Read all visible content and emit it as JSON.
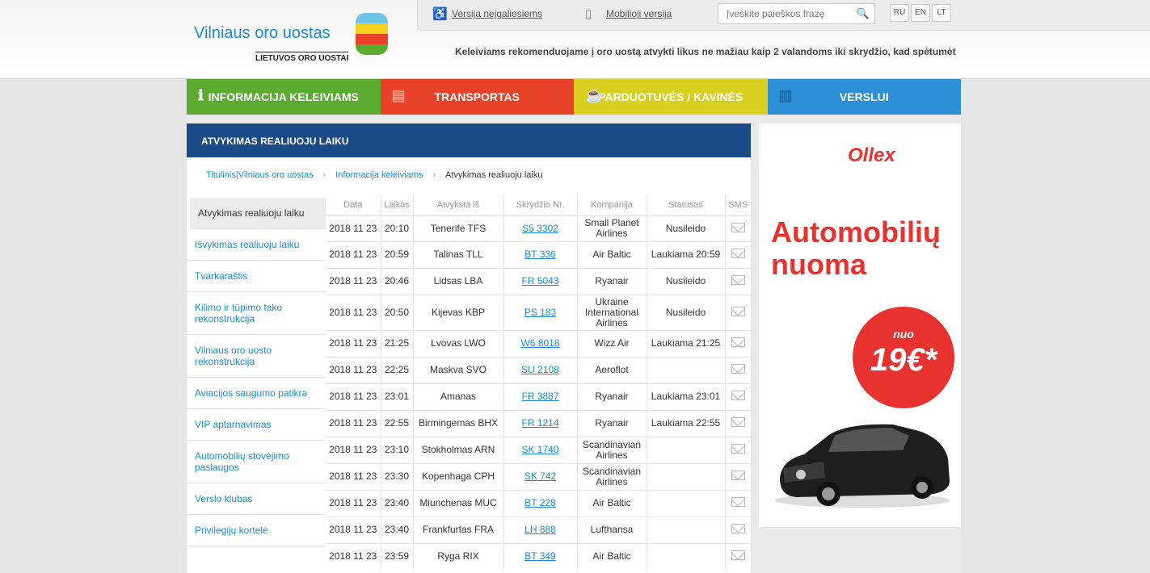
{
  "header": {
    "logo_title": "Vilniaus oro uostas",
    "logo_subtitle": "LIETUVOS ORO UOSTAI",
    "accessible_version": "Versija neįgaliesiems",
    "mobile_version": "Mobilioji versija",
    "search_placeholder": "Įveskite paieškos frazę",
    "languages": [
      "RU",
      "EN",
      "LT"
    ],
    "notice": "Keleiviams rekomenduojame į oro uostą atvykti likus ne mažiau kaip 2 valandoms iki skrydžio, kad spėtumėte"
  },
  "nav": [
    {
      "label": "INFORMACIJA KELEIVIAMS",
      "color": "#5aab2f",
      "icon": "info-icon"
    },
    {
      "label": "TRANSPORTAS",
      "color": "#e8432a",
      "icon": "document-icon"
    },
    {
      "label": "PARDUOTUVĖS / KAVINĖS",
      "color": "#d9cf1f",
      "icon": "cup-icon"
    },
    {
      "label": "VERSLUI",
      "color": "#2d8fd5",
      "icon": "bar-chart-icon"
    }
  ],
  "panel": {
    "title": "ATVYKIMAS REALIUOJU LAIKU",
    "breadcrumb": [
      "Titulinis|Vilniaus oro uostas",
      "Informacija keleiviams",
      "Atvykimas realiuoju laiku"
    ]
  },
  "sidebar": [
    "Atvykimas realiuoju laiku",
    "Išvykimas realiuoju laiku",
    "Tvarkaraštis",
    "Kilimo ir tūpimo tako rekonstrukcija",
    "Vilniaus oro uosto rekonstrukcija",
    "Aviacijos saugumo patikra",
    "VIP aptarnavimas",
    "Automobilių stovėjimo paslaugos",
    "Verslo klubas",
    "Privilegijų kortelė"
  ],
  "table": {
    "headers": [
      "Data",
      "Laikas",
      "Atvyksta iš",
      "Skrydžio Nr.",
      "Kompanija",
      "Statusas",
      "SMS"
    ],
    "rows": [
      [
        "2018 11 23",
        "20:10",
        "Tenerifė TFS",
        "S5 3302",
        "Small Planet Airlines",
        "Nusileido"
      ],
      [
        "2018 11 23",
        "20:59",
        "Talinas TLL",
        "BT 336",
        "Air Baltic",
        "Laukiama 20:59"
      ],
      [
        "2018 11 23",
        "20:46",
        "Lidsas LBA",
        "FR 5043",
        "Ryanair",
        "Nusileido"
      ],
      [
        "2018 11 23",
        "20:50",
        "Kijevas KBP",
        "PS 183",
        "Ukraine International Airlines",
        "Nusileido"
      ],
      [
        "2018 11 23",
        "21:25",
        "Lvovas LWO",
        "W6 8018",
        "Wizz Air",
        "Laukiama 21:25"
      ],
      [
        "2018 11 23",
        "22:25",
        "Maskva SVO",
        "SU 2108",
        "Aeroflot",
        ""
      ],
      [
        "2018 11 23",
        "23:01",
        "Amanas",
        "FR 3887",
        "Ryanair",
        "Laukiama 23:01"
      ],
      [
        "2018 11 23",
        "22:55",
        "Birmingemas BHX",
        "FR 1214",
        "Ryanair",
        "Laukiama 22:55"
      ],
      [
        "2018 11 23",
        "23:10",
        "Stokholmas ARN",
        "SK 1740",
        "Scandinavian Airlines",
        ""
      ],
      [
        "2018 11 23",
        "23:30",
        "Kopenhaga CPH",
        "SK 742",
        "Scandinavian Airlines",
        ""
      ],
      [
        "2018 11 23",
        "23:40",
        "Miunchenas MUC",
        "BT 228",
        "Air Baltic",
        ""
      ],
      [
        "2018 11 23",
        "23:40",
        "Frankfurtas FRA",
        "LH 888",
        "Lufthansa",
        ""
      ],
      [
        "2018 11 23",
        "23:59",
        "Ryga RIX",
        "BT 349",
        "Air Baltic",
        ""
      ]
    ]
  },
  "ad": {
    "brand": "Ollex",
    "title": "Automobilių nuoma",
    "price_prefix": "nuo",
    "price": "19€*"
  }
}
